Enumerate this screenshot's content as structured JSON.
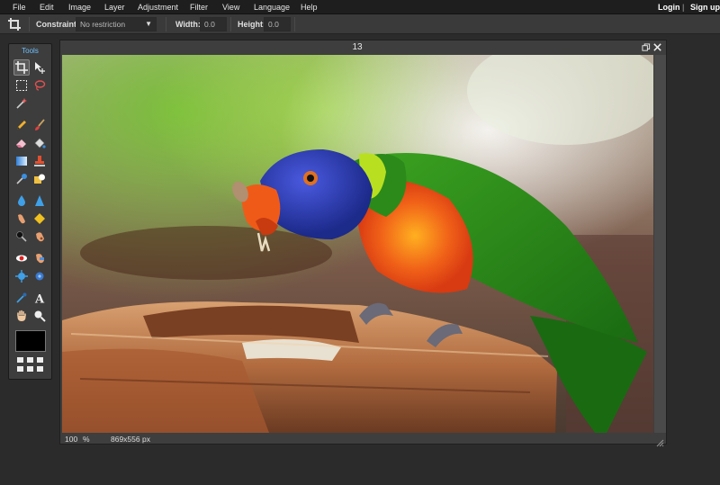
{
  "menu": {
    "items": [
      "File",
      "Edit",
      "Image",
      "Layer",
      "Adjustment",
      "Filter",
      "View",
      "Language",
      "Help"
    ],
    "login": "Login",
    "separator": "|",
    "signup": "Sign up"
  },
  "options": {
    "constraint_label": "Constraint:",
    "constraint_value": "No restriction",
    "width_label": "Width:",
    "width_value": "0.0",
    "height_label": "Height:",
    "height_value": "0.0"
  },
  "tools": {
    "title": "Tools",
    "icons": [
      "crop-icon",
      "move-icon",
      "marquee-icon",
      "lasso-icon",
      "magic-wand-icon",
      "pencil-icon",
      "brush-icon",
      "eraser-icon",
      "paint-bucket-icon",
      "gradient-icon",
      "clone-stamp-icon",
      "color-replace-icon",
      "drawing-icon",
      "blur-icon",
      "sharpen-icon",
      "smudge-icon",
      "sponge-icon",
      "dodge-icon",
      "burn-icon",
      "red-eye-icon",
      "spot-heal-icon",
      "bloat-icon",
      "pinch-icon",
      "color-picker-icon",
      "type-icon",
      "hand-icon",
      "zoom-icon"
    ]
  },
  "window": {
    "title": "13",
    "zoom": "100",
    "zoom_unit": "%",
    "dimensions": "869x556 px"
  },
  "colors": {
    "accent": "#6ec0ff",
    "background": "#2b2b2b",
    "panel": "#3d3d3d",
    "foreground_color": "#000000"
  }
}
